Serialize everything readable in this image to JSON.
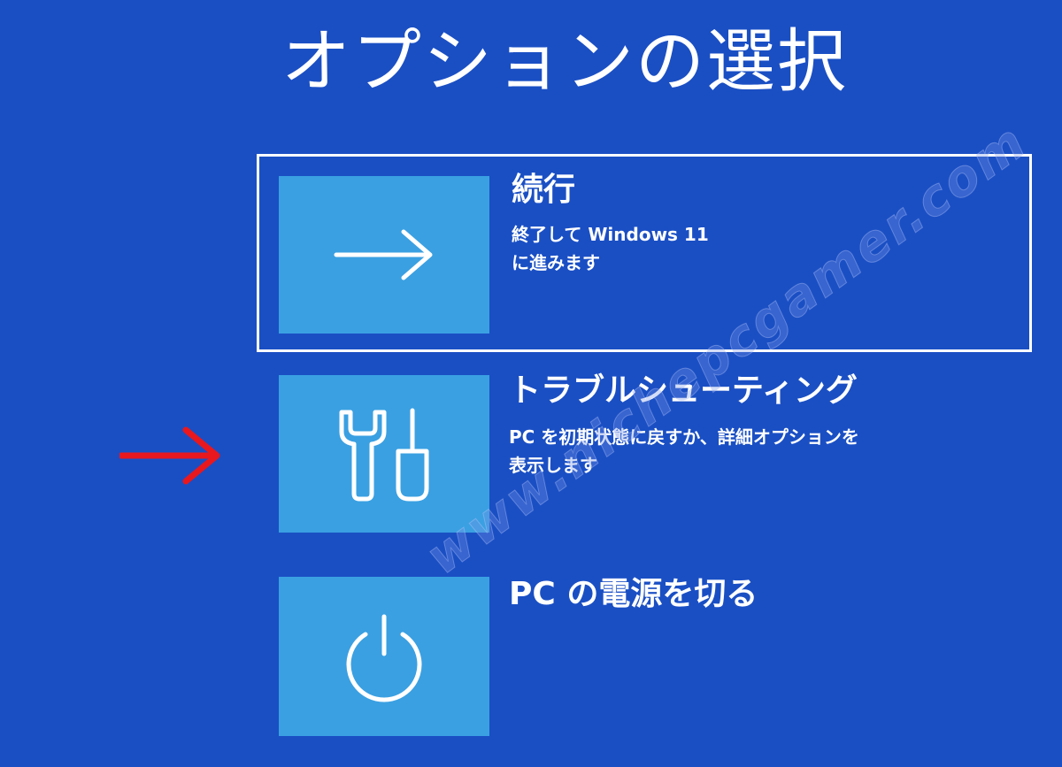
{
  "page": {
    "title": "オプションの選択",
    "background_color": "#1a4fc4",
    "tile_color": "#3aa0e2"
  },
  "options": [
    {
      "id": "continue",
      "title": "続行",
      "description": "終了して Windows 11\nに進みます",
      "icon": "arrow-right-icon",
      "selected": true
    },
    {
      "id": "troubleshoot",
      "title": "トラブルシューティング",
      "description": "PC を初期状態に戻すか、詳細オプションを\n表示します",
      "icon": "tools-icon",
      "selected": false
    },
    {
      "id": "shutdown",
      "title": "PC の電源を切る",
      "icon": "power-icon",
      "selected": false
    }
  ],
  "annotation": {
    "arrow_color": "#e8181e",
    "icon": "red-arrow-icon"
  },
  "watermark": {
    "text": "www.nichepcgamer.com"
  }
}
